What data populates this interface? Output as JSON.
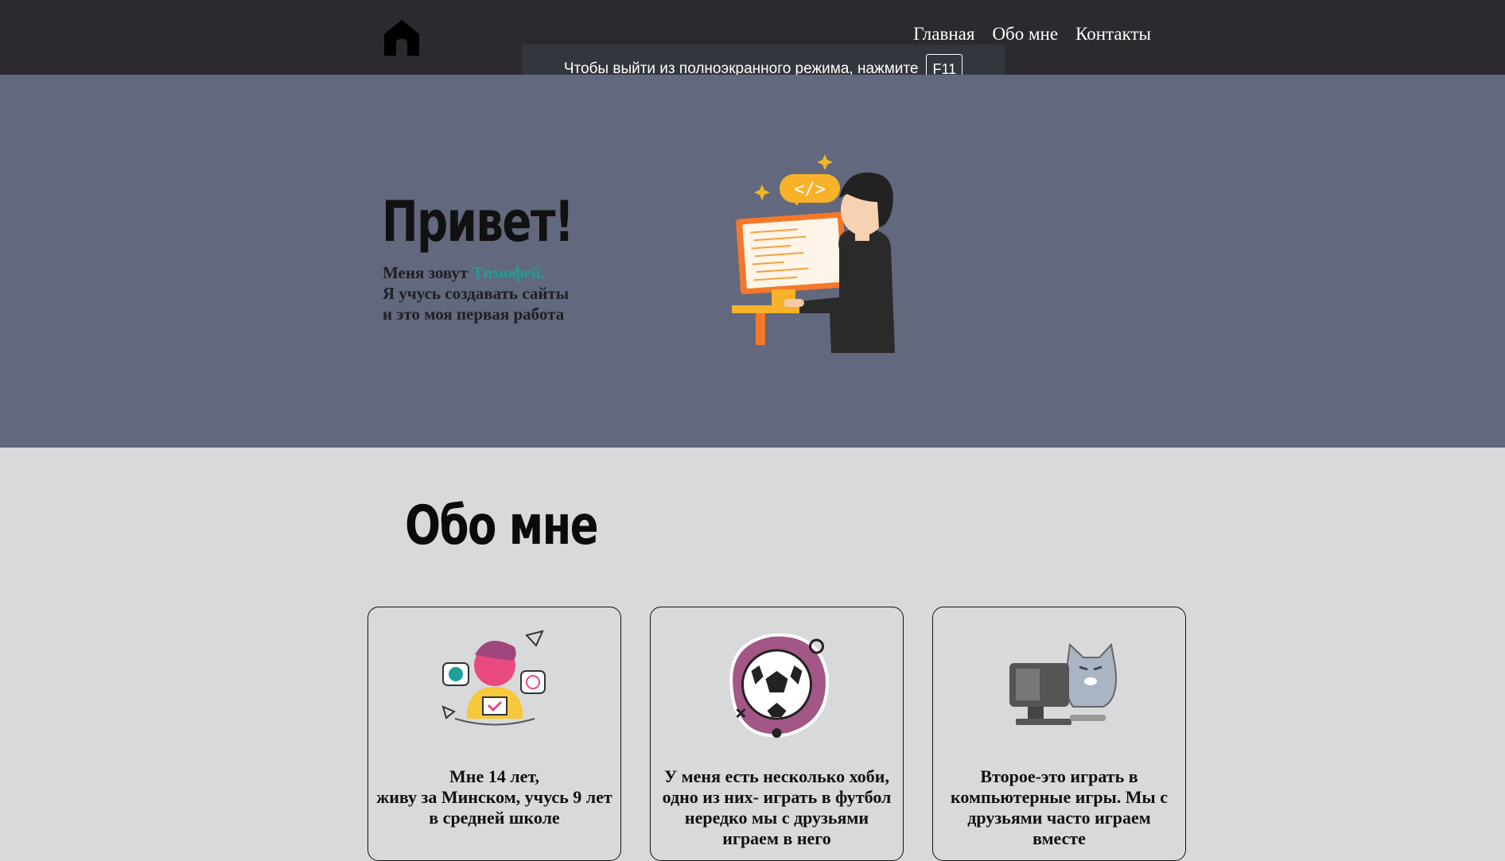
{
  "header": {
    "nav": [
      "Главная",
      "Обо мне",
      "Контакты"
    ]
  },
  "toast": {
    "text": "Чтобы выйти из полноэкранного режима, нажмите",
    "key": "F11"
  },
  "hero": {
    "title": "Привет!",
    "line1_prefix": "Меня зовут ",
    "name": "Тимофей.",
    "line2": "Я учусь создавать сайты",
    "line3": "и это моя первая работа"
  },
  "about": {
    "title": "Обо мне",
    "cards": [
      {
        "text": "Мне 14 лет,\nживу за Минском, учусь 9 лет в средней школе",
        "icon": "student-icon"
      },
      {
        "text": "У меня есть несколько хоби, одно из них- играть в футбол нередко мы с друзьями играем в него",
        "icon": "soccer-ball-icon"
      },
      {
        "text": "Второе-это играть в компьютерные игры. Мы с друзьями часто играем вместе",
        "icon": "cat-computer-icon"
      }
    ]
  },
  "colors": {
    "header_bg": "#2b2b2f",
    "hero_bg": "#62687d",
    "page_bg": "#d8d9db",
    "accent_name": "#1f9f98"
  }
}
